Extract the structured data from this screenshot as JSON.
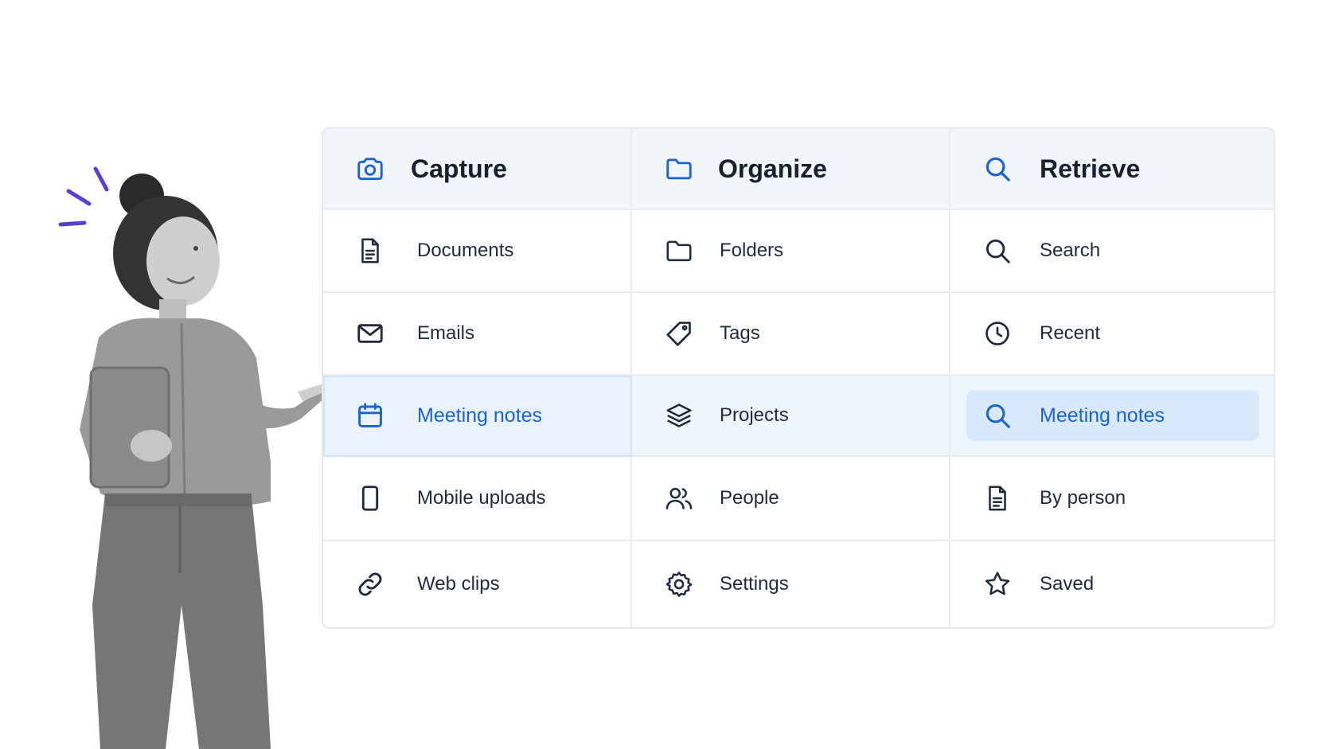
{
  "columns": [
    {
      "header": {
        "label": "Capture",
        "icon": "camera-icon"
      },
      "items": [
        {
          "label": "Documents",
          "icon": "document-icon"
        },
        {
          "label": "Emails",
          "icon": "mail-icon"
        },
        {
          "label": "Meeting notes",
          "icon": "calendar-icon",
          "highlighted": true
        },
        {
          "label": "Mobile uploads",
          "icon": "phone-icon"
        },
        {
          "label": "Web clips",
          "icon": "link-icon"
        }
      ]
    },
    {
      "header": {
        "label": "Organize",
        "icon": "folder-icon"
      },
      "items": [
        {
          "label": "Folders",
          "icon": "folder-icon"
        },
        {
          "label": "Tags",
          "icon": "tag-icon"
        },
        {
          "label": "Projects",
          "icon": "layers-icon"
        },
        {
          "label": "People",
          "icon": "people-icon"
        },
        {
          "label": "Settings",
          "icon": "gear-icon"
        }
      ]
    },
    {
      "header": {
        "label": "Retrieve",
        "icon": "search-icon"
      },
      "items": [
        {
          "label": "Search",
          "icon": "search-icon"
        },
        {
          "label": "Recent",
          "icon": "clock-icon"
        },
        {
          "label": "Meeting notes",
          "icon": "search-icon",
          "highlighted": true
        },
        {
          "label": "By person",
          "icon": "document-icon"
        },
        {
          "label": "Saved",
          "icon": "star-icon"
        }
      ]
    }
  ],
  "colors": {
    "accent": "#1a63d6",
    "header_bg": "#f2f6fb",
    "highlight_row": "#eef5fe",
    "pill": "#d9e8fb",
    "text": "#1f2a3a"
  }
}
